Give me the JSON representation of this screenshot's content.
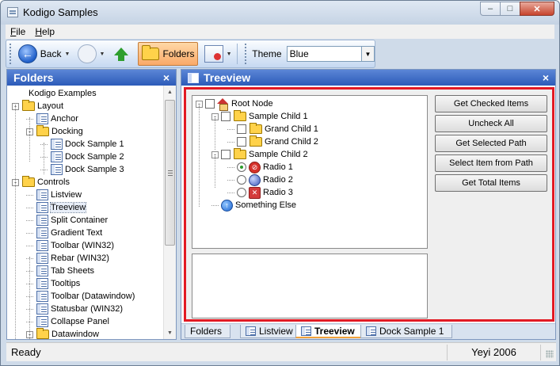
{
  "window": {
    "title": "Kodigo Samples",
    "min": "–",
    "max": "□",
    "close": "✕"
  },
  "menu": [
    {
      "label": "File"
    },
    {
      "label": "Help"
    }
  ],
  "toolbar": {
    "back_label": "Back",
    "folders_label": "Folders",
    "theme_label": "Theme",
    "theme_value": "Blue"
  },
  "left_panel": {
    "title": "Folders",
    "close": "×",
    "items": [
      {
        "label": "Kodigo Examples",
        "level": 0,
        "type": "none",
        "expander": ""
      },
      {
        "label": "Layout",
        "level": 0,
        "type": "folder",
        "expander": "-"
      },
      {
        "label": "Anchor",
        "level": 1,
        "type": "page",
        "expander": ""
      },
      {
        "label": "Docking",
        "level": 1,
        "type": "folder",
        "expander": "-"
      },
      {
        "label": "Dock Sample 1",
        "level": 2,
        "type": "page",
        "expander": ""
      },
      {
        "label": "Dock Sample 2",
        "level": 2,
        "type": "page",
        "expander": ""
      },
      {
        "label": "Dock Sample 3",
        "level": 2,
        "type": "page",
        "expander": ""
      },
      {
        "label": "Controls",
        "level": 0,
        "type": "folder",
        "expander": "-"
      },
      {
        "label": "Listview",
        "level": 1,
        "type": "page",
        "expander": ""
      },
      {
        "label": "Treeview",
        "level": 1,
        "type": "page",
        "expander": "",
        "selected": true
      },
      {
        "label": "Split Container",
        "level": 1,
        "type": "page",
        "expander": ""
      },
      {
        "label": "Gradient Text",
        "level": 1,
        "type": "page",
        "expander": ""
      },
      {
        "label": "Toolbar (WIN32)",
        "level": 1,
        "type": "page",
        "expander": ""
      },
      {
        "label": "Rebar (WIN32)",
        "level": 1,
        "type": "page",
        "expander": ""
      },
      {
        "label": "Tab Sheets",
        "level": 1,
        "type": "page",
        "expander": ""
      },
      {
        "label": "Tooltips",
        "level": 1,
        "type": "page",
        "expander": ""
      },
      {
        "label": "Toolbar (Datawindow)",
        "level": 1,
        "type": "page",
        "expander": ""
      },
      {
        "label": "Statusbar (WIN32)",
        "level": 1,
        "type": "page",
        "expander": ""
      },
      {
        "label": "Collapse Panel",
        "level": 1,
        "type": "page",
        "expander": ""
      },
      {
        "label": "Datawindow",
        "level": 1,
        "type": "folder",
        "expander": "-"
      }
    ]
  },
  "main_panel": {
    "title": "Treeview",
    "close": "×",
    "tree": [
      {
        "label": "Root Node",
        "level": 0,
        "expander": "-",
        "control": "check",
        "icon": "house"
      },
      {
        "label": "Sample Child 1",
        "level": 1,
        "expander": "-",
        "control": "check",
        "icon": "folder"
      },
      {
        "label": "Grand Child 1",
        "level": 2,
        "expander": "",
        "control": "check",
        "icon": "folder"
      },
      {
        "label": "Grand Child 2",
        "level": 2,
        "expander": "",
        "control": "check",
        "icon": "folder"
      },
      {
        "label": "Sample Child 2",
        "level": 1,
        "expander": "-",
        "control": "check",
        "icon": "folder"
      },
      {
        "label": "Radio 1",
        "level": 2,
        "expander": "",
        "control": "radio-on",
        "icon": "stop"
      },
      {
        "label": "Radio 2",
        "level": 2,
        "expander": "",
        "control": "radio",
        "icon": "globe"
      },
      {
        "label": "Radio 3",
        "level": 2,
        "expander": "",
        "control": "radio",
        "icon": "errx"
      },
      {
        "label": "Something Else",
        "level": 1,
        "expander": "",
        "control": "none",
        "icon": "info"
      }
    ],
    "buttons": [
      {
        "label": "Get Checked Items"
      },
      {
        "label": "Uncheck All"
      },
      {
        "label": "Get Selected Path"
      },
      {
        "label": "Select Item from Path"
      },
      {
        "label": "Get Total Items"
      }
    ],
    "tabs": [
      {
        "label": "Folders",
        "icon": "none"
      },
      {
        "label": "Listview",
        "icon": "page"
      },
      {
        "label": "Treeview",
        "icon": "page",
        "active": true
      },
      {
        "label": "Dock Sample 1",
        "icon": "page"
      }
    ]
  },
  "status": {
    "left": "Ready",
    "right": "Yeyi 2006"
  },
  "colors": {
    "accent": "#2c5bb9",
    "highlight": "#e21a24",
    "tab_active": "#f2a23a"
  }
}
